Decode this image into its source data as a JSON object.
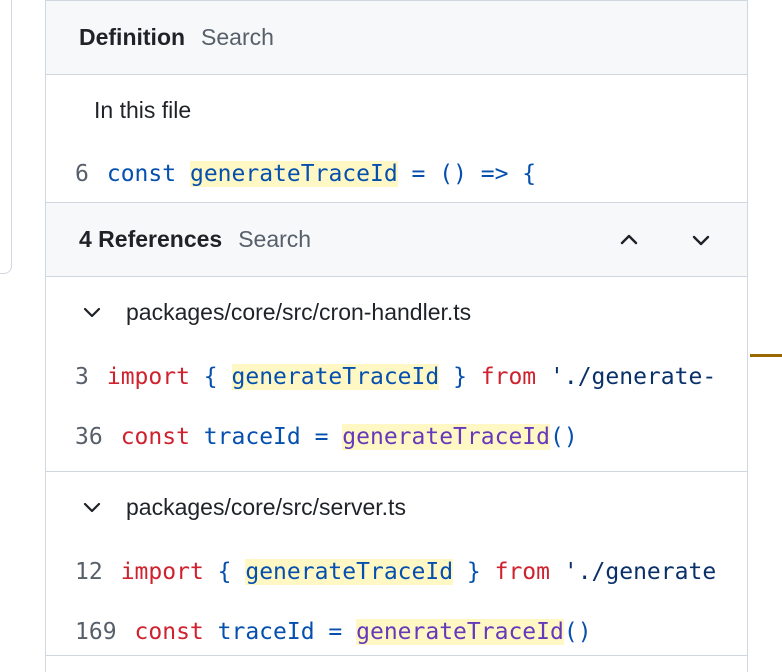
{
  "definition_header": {
    "title": "Definition",
    "search_label": "Search"
  },
  "definition_section": {
    "label": "In this file",
    "line": {
      "number": "6",
      "kw": "const",
      "symbol": "generateTraceId",
      "rest": " = () => {"
    }
  },
  "references_header": {
    "title": "4 References",
    "search_label": "Search",
    "prev_icon": "chevron-up-icon",
    "next_icon": "chevron-down-icon"
  },
  "files": [
    {
      "path": "packages/core/src/cron-handler.ts",
      "lines": [
        {
          "number": "3",
          "kw": "import",
          "open": " { ",
          "symbol": "generateTraceId",
          "close": " } ",
          "from": "from",
          "str": " './generate-"
        },
        {
          "number": "36",
          "kw": "const",
          "var": " traceId = ",
          "symbol": "generateTraceId",
          "call": "()"
        }
      ]
    },
    {
      "path": "packages/core/src/server.ts",
      "lines": [
        {
          "number": "12",
          "kw": "import",
          "open": " { ",
          "symbol": "generateTraceId",
          "close": " } ",
          "from": "from",
          "str": " './generate"
        },
        {
          "number": "169",
          "kw": "const",
          "var": " traceId = ",
          "symbol": "generateTraceId",
          "call": "()"
        }
      ]
    }
  ],
  "colors": {
    "keyword_blue": "#0550ae",
    "keyword_red": "#cf222e",
    "function_purple": "#6639ba",
    "highlight": "#fff8c5",
    "accent_gold": "#9a6700"
  }
}
